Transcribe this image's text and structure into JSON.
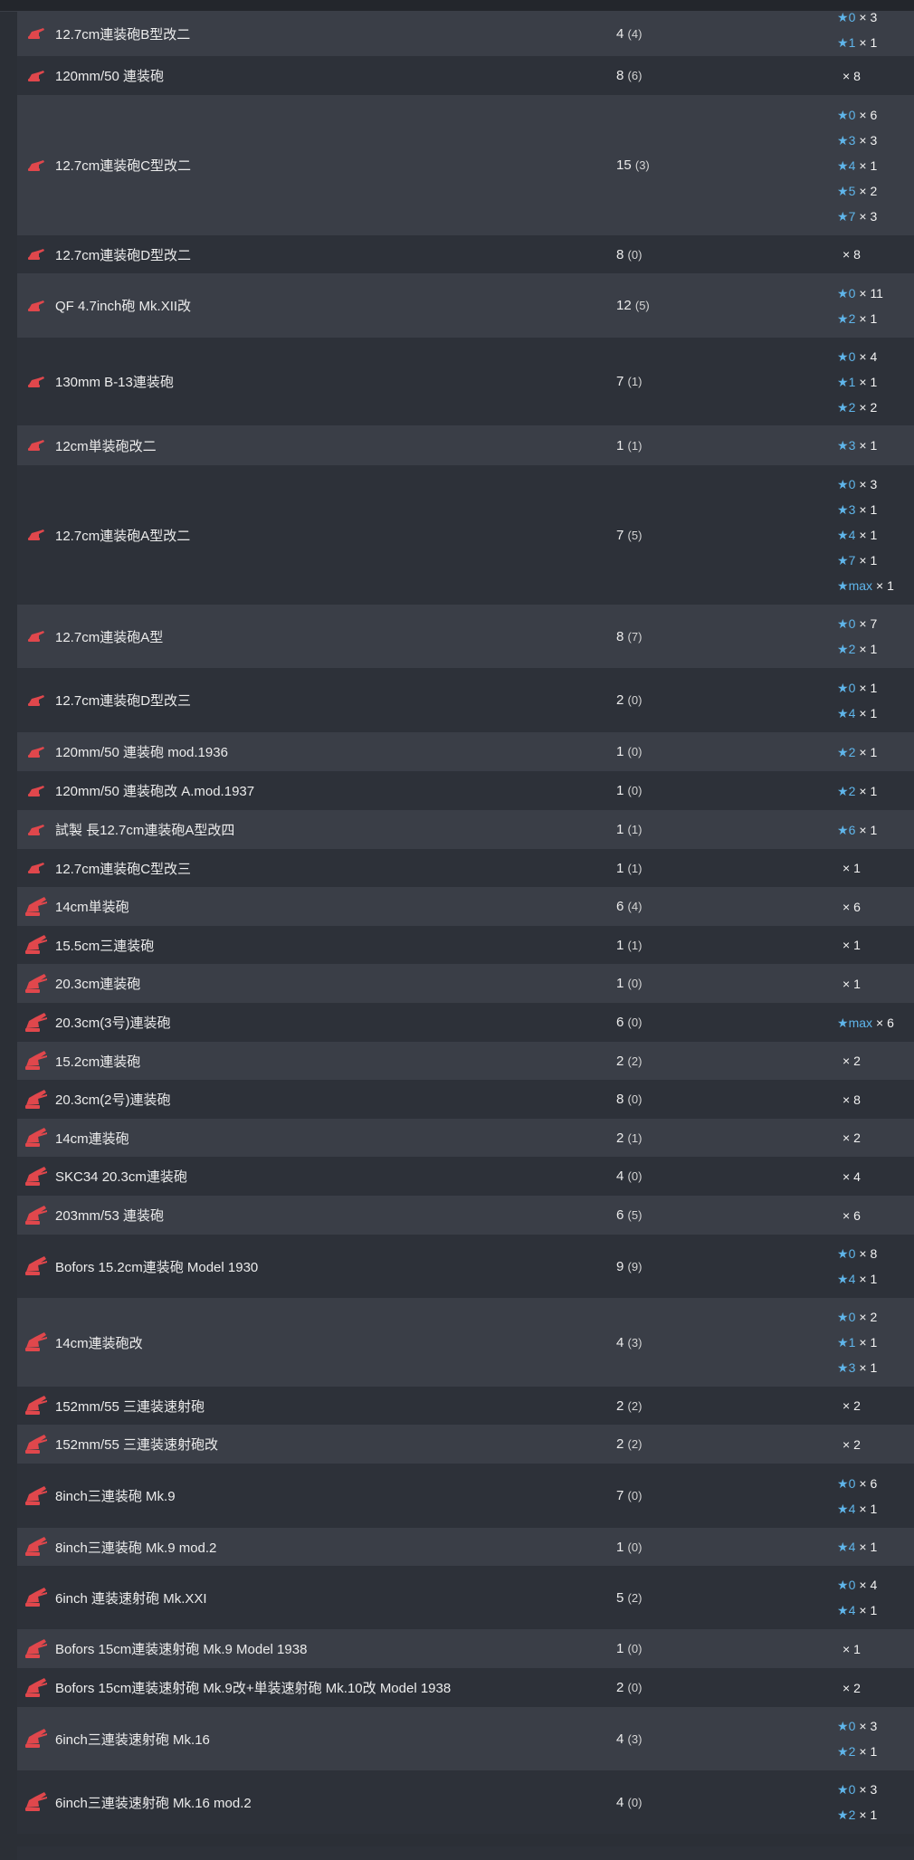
{
  "rows": [
    {
      "name": "12.7cm連装砲B型改二",
      "count": "4",
      "sub": "(4)",
      "icon": "small-gun-icon",
      "h": 50,
      "stars": [
        {
          "lvl": "0",
          "n": "3"
        },
        {
          "lvl": "1",
          "n": "1"
        }
      ]
    },
    {
      "name": "120mm/50 連装砲",
      "count": "8",
      "sub": "(6)",
      "icon": "small-gun-icon",
      "h": 43,
      "stars": [
        {
          "lvl": "",
          "n": "8"
        }
      ]
    },
    {
      "name": "12.7cm連装砲C型改二",
      "count": "15",
      "sub": "(3)",
      "icon": "small-gun-icon",
      "h": 155,
      "stars": [
        {
          "lvl": "0",
          "n": "6"
        },
        {
          "lvl": "3",
          "n": "3"
        },
        {
          "lvl": "4",
          "n": "1"
        },
        {
          "lvl": "5",
          "n": "2"
        },
        {
          "lvl": "7",
          "n": "3"
        }
      ]
    },
    {
      "name": "12.7cm連装砲D型改二",
      "count": "8",
      "sub": "(0)",
      "icon": "small-gun-icon",
      "h": 42,
      "stars": [
        {
          "lvl": "",
          "n": "8"
        }
      ]
    },
    {
      "name": "QF 4.7inch砲 Mk.XII改",
      "count": "12",
      "sub": "(5)",
      "icon": "small-gun-icon",
      "h": 71,
      "stars": [
        {
          "lvl": "0",
          "n": "11"
        },
        {
          "lvl": "2",
          "n": "1"
        }
      ]
    },
    {
      "name": "130mm B-13連装砲",
      "count": "7",
      "sub": "(1)",
      "icon": "small-gun-icon",
      "h": 97,
      "stars": [
        {
          "lvl": "0",
          "n": "4"
        },
        {
          "lvl": "1",
          "n": "1"
        },
        {
          "lvl": "2",
          "n": "2"
        }
      ]
    },
    {
      "name": "12cm単装砲改二",
      "count": "1",
      "sub": "(1)",
      "icon": "small-gun-icon",
      "h": 44,
      "stars": [
        {
          "lvl": "3",
          "n": "1"
        }
      ]
    },
    {
      "name": "12.7cm連装砲A型改二",
      "count": "7",
      "sub": "(5)",
      "icon": "small-gun-icon",
      "h": 154,
      "stars": [
        {
          "lvl": "0",
          "n": "3"
        },
        {
          "lvl": "3",
          "n": "1"
        },
        {
          "lvl": "4",
          "n": "1"
        },
        {
          "lvl": "7",
          "n": "1"
        },
        {
          "lvl": "max",
          "n": "1"
        }
      ]
    },
    {
      "name": "12.7cm連装砲A型",
      "count": "8",
      "sub": "(7)",
      "icon": "small-gun-icon",
      "h": 70,
      "stars": [
        {
          "lvl": "0",
          "n": "7"
        },
        {
          "lvl": "2",
          "n": "1"
        }
      ]
    },
    {
      "name": "12.7cm連装砲D型改三",
      "count": "2",
      "sub": "(0)",
      "icon": "small-gun-icon",
      "h": 71,
      "stars": [
        {
          "lvl": "0",
          "n": "1"
        },
        {
          "lvl": "4",
          "n": "1"
        }
      ]
    },
    {
      "name": "120mm/50 連装砲 mod.1936",
      "count": "1",
      "sub": "(0)",
      "icon": "small-gun-icon",
      "h": 43,
      "stars": [
        {
          "lvl": "2",
          "n": "1"
        }
      ]
    },
    {
      "name": "120mm/50 連装砲改 A.mod.1937",
      "count": "1",
      "sub": "(0)",
      "icon": "small-gun-icon",
      "h": 43,
      "stars": [
        {
          "lvl": "2",
          "n": "1"
        }
      ]
    },
    {
      "name": "試製 長12.7cm連装砲A型改四",
      "count": "1",
      "sub": "(1)",
      "icon": "small-gun-icon",
      "h": 43,
      "stars": [
        {
          "lvl": "6",
          "n": "1"
        }
      ]
    },
    {
      "name": "12.7cm連装砲C型改三",
      "count": "1",
      "sub": "(1)",
      "icon": "small-gun-icon",
      "h": 42,
      "stars": [
        {
          "lvl": "",
          "n": "1"
        }
      ]
    },
    {
      "name": "14cm単装砲",
      "count": "6",
      "sub": "(4)",
      "icon": "medium-gun-icon",
      "h": 43,
      "stars": [
        {
          "lvl": "",
          "n": "6"
        }
      ]
    },
    {
      "name": "15.5cm三連装砲",
      "count": "1",
      "sub": "(1)",
      "icon": "medium-gun-icon",
      "h": 42,
      "stars": [
        {
          "lvl": "",
          "n": "1"
        }
      ]
    },
    {
      "name": "20.3cm連装砲",
      "count": "1",
      "sub": "(0)",
      "icon": "medium-gun-icon",
      "h": 43,
      "stars": [
        {
          "lvl": "",
          "n": "1"
        }
      ]
    },
    {
      "name": "20.3cm(3号)連装砲",
      "count": "6",
      "sub": "(0)",
      "icon": "medium-gun-icon",
      "h": 43,
      "stars": [
        {
          "lvl": "max",
          "n": "6"
        }
      ]
    },
    {
      "name": "15.2cm連装砲",
      "count": "2",
      "sub": "(2)",
      "icon": "medium-gun-icon",
      "h": 42,
      "stars": [
        {
          "lvl": "",
          "n": "2"
        }
      ]
    },
    {
      "name": "20.3cm(2号)連装砲",
      "count": "8",
      "sub": "(0)",
      "icon": "medium-gun-icon",
      "h": 43,
      "stars": [
        {
          "lvl": "",
          "n": "8"
        }
      ]
    },
    {
      "name": "14cm連装砲",
      "count": "2",
      "sub": "(1)",
      "icon": "medium-gun-icon",
      "h": 42,
      "stars": [
        {
          "lvl": "",
          "n": "2"
        }
      ]
    },
    {
      "name": "SKC34 20.3cm連装砲",
      "count": "4",
      "sub": "(0)",
      "icon": "medium-gun-icon",
      "h": 43,
      "stars": [
        {
          "lvl": "",
          "n": "4"
        }
      ]
    },
    {
      "name": "203mm/53 連装砲",
      "count": "6",
      "sub": "(5)",
      "icon": "medium-gun-icon",
      "h": 43,
      "stars": [
        {
          "lvl": "",
          "n": "6"
        }
      ]
    },
    {
      "name": "Bofors 15.2cm連装砲 Model 1930",
      "count": "9",
      "sub": "(9)",
      "icon": "medium-gun-icon",
      "h": 70,
      "stars": [
        {
          "lvl": "0",
          "n": "8"
        },
        {
          "lvl": "4",
          "n": "1"
        }
      ]
    },
    {
      "name": "14cm連装砲改",
      "count": "4",
      "sub": "(3)",
      "icon": "medium-gun-icon",
      "h": 98,
      "stars": [
        {
          "lvl": "0",
          "n": "2"
        },
        {
          "lvl": "1",
          "n": "1"
        },
        {
          "lvl": "3",
          "n": "1"
        }
      ]
    },
    {
      "name": "152mm/55 三連装速射砲",
      "count": "2",
      "sub": "(2)",
      "icon": "medium-gun-icon",
      "h": 42,
      "stars": [
        {
          "lvl": "",
          "n": "2"
        }
      ]
    },
    {
      "name": "152mm/55 三連装速射砲改",
      "count": "2",
      "sub": "(2)",
      "icon": "medium-gun-icon",
      "h": 43,
      "stars": [
        {
          "lvl": "",
          "n": "2"
        }
      ]
    },
    {
      "name": "8inch三連装砲 Mk.9",
      "count": "7",
      "sub": "(0)",
      "icon": "medium-gun-icon",
      "h": 71,
      "stars": [
        {
          "lvl": "0",
          "n": "6"
        },
        {
          "lvl": "4",
          "n": "1"
        }
      ]
    },
    {
      "name": "8inch三連装砲 Mk.9 mod.2",
      "count": "1",
      "sub": "(0)",
      "icon": "medium-gun-icon",
      "h": 42,
      "stars": [
        {
          "lvl": "4",
          "n": "1"
        }
      ]
    },
    {
      "name": "6inch 連装速射砲 Mk.XXI",
      "count": "5",
      "sub": "(2)",
      "icon": "medium-gun-icon",
      "h": 70,
      "stars": [
        {
          "lvl": "0",
          "n": "4"
        },
        {
          "lvl": "4",
          "n": "1"
        }
      ]
    },
    {
      "name": "Bofors 15cm連装速射砲 Mk.9 Model 1938",
      "count": "1",
      "sub": "(0)",
      "icon": "medium-gun-icon",
      "h": 43,
      "stars": [
        {
          "lvl": "",
          "n": "1"
        }
      ]
    },
    {
      "name": "Bofors 15cm連装速射砲 Mk.9改+単装速射砲 Mk.10改 Model 1938",
      "count": "2",
      "sub": "(0)",
      "icon": "medium-gun-icon",
      "h": 43,
      "stars": [
        {
          "lvl": "",
          "n": "2"
        }
      ]
    },
    {
      "name": "6inch三連装速射砲 Mk.16",
      "count": "4",
      "sub": "(3)",
      "icon": "medium-gun-icon",
      "h": 70,
      "stars": [
        {
          "lvl": "0",
          "n": "3"
        },
        {
          "lvl": "2",
          "n": "1"
        }
      ]
    },
    {
      "name": "6inch三連装速射砲 Mk.16 mod.2",
      "count": "4",
      "sub": "(0)",
      "icon": "medium-gun-icon",
      "h": 70,
      "stars": [
        {
          "lvl": "0",
          "n": "3"
        },
        {
          "lvl": "2",
          "n": "1"
        }
      ]
    }
  ],
  "colors": {
    "star": "#5fb5ea",
    "icon": "#e0474c"
  }
}
